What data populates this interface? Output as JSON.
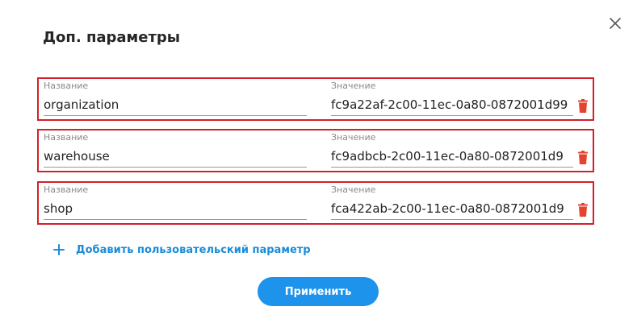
{
  "dialog": {
    "title": "Доп. параметры",
    "close_icon": "close-icon"
  },
  "params": [
    {
      "name_label": "Название",
      "name_value": "organization",
      "value_label": "Значение",
      "value_value": "fc9a22af-2c00-11ec-0a80-0872001d99"
    },
    {
      "name_label": "Название",
      "name_value": "warehouse",
      "value_label": "Значение",
      "value_value": "fc9adbcb-2c00-11ec-0a80-0872001d9"
    },
    {
      "name_label": "Название",
      "name_value": "shop",
      "value_label": "Значение",
      "value_value": "fca422ab-2c00-11ec-0a80-0872001d9"
    }
  ],
  "add_param": {
    "label": "Добавить пользовательский параметр",
    "icon": "plus-icon"
  },
  "apply_button": {
    "label": "Применить"
  },
  "colors": {
    "accent": "#1e93ec",
    "link": "#1a8cd8",
    "highlight_border": "#d4202a",
    "delete_icon": "#e5432f"
  }
}
